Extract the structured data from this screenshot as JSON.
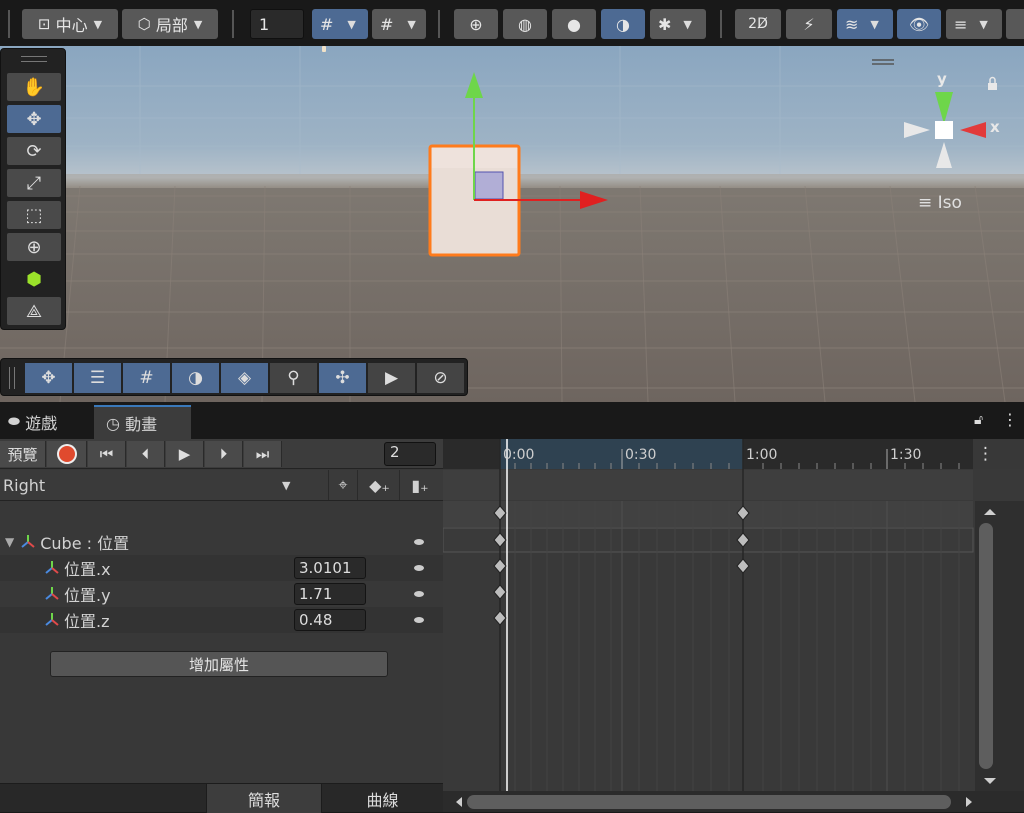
{
  "toolbar": {
    "pivot_label": "中心",
    "space_label": "局部",
    "grid_size_value": "1"
  },
  "scene": {
    "gizmo_y_label": "y",
    "gizmo_x_label": "x",
    "projection_label": "Iso",
    "colors": {
      "y_axis": "#6ed64a",
      "x_axis": "#e02020",
      "selection_outline": "#ff7b1c"
    }
  },
  "window_tabs": [
    {
      "label": "遊戲",
      "icon": "gamepad-icon"
    },
    {
      "label": "動畫",
      "icon": "clock-icon"
    }
  ],
  "animation": {
    "preview_label": "預覽",
    "frame_value": "2",
    "clip_name": "Right",
    "group_label": "Cube : 位置",
    "properties": [
      {
        "label": "位置.x",
        "value": "3.0101"
      },
      {
        "label": "位置.y",
        "value": "1.71"
      },
      {
        "label": "位置.z",
        "value": "0.48"
      }
    ],
    "add_property_label": "增加屬性",
    "bottom_tabs": [
      "簡報",
      "曲線"
    ],
    "timeline_labels": [
      "0:00",
      "0:30",
      "1:00",
      "1:30"
    ]
  }
}
